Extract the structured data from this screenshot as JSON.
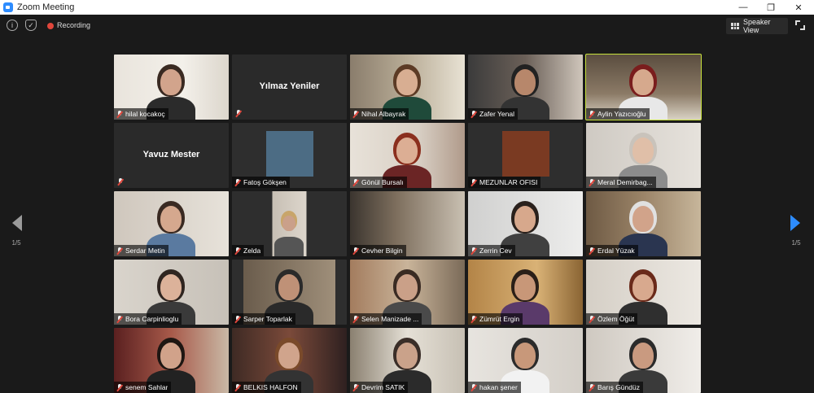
{
  "window": {
    "title": "Zoom Meeting",
    "minimize": "—",
    "maximize": "❐",
    "close": "✕"
  },
  "toolbar": {
    "info_icon": "i",
    "shield_icon": "✓",
    "recording_label": "Recording",
    "speaker_view_label": "Speaker View"
  },
  "pagination": {
    "prev_page": "1/5",
    "next_page": "1/5"
  },
  "colors": {
    "active_speaker_border": "#c6e03a",
    "muted_icon": "#e0463b",
    "nav_next": "#2d8cff",
    "zoom_brand": "#2d8cff"
  },
  "participants": [
    {
      "name": "hilal kocakoç",
      "video": true
    },
    {
      "name": "Yılmaz Yeniler",
      "video": false
    },
    {
      "name": "Nihal Albayrak",
      "video": true
    },
    {
      "name": "Zafer Yenal",
      "video": true
    },
    {
      "name": "Aylin Yazıcıoğlu",
      "video": true,
      "active_speaker": true
    },
    {
      "name": "Yavuz Mester",
      "video": false
    },
    {
      "name": "Fatoş Gökşen",
      "video": true
    },
    {
      "name": "Gönül Bursalı",
      "video": true
    },
    {
      "name": "MEZUNLAR OFISI",
      "video": true
    },
    {
      "name": "Meral Demirbag...",
      "video": true
    },
    {
      "name": "Serdar Metin",
      "video": true
    },
    {
      "name": "Zelda",
      "video": true
    },
    {
      "name": "Cevher Bilgin",
      "video": true
    },
    {
      "name": "Zerrin Cev",
      "video": true
    },
    {
      "name": "Erdal Yüzak",
      "video": true
    },
    {
      "name": "Bora Carpinlioglu",
      "video": true
    },
    {
      "name": "Sarper Toparlak",
      "video": true
    },
    {
      "name": "Selen Manizade ...",
      "video": true
    },
    {
      "name": "Zümrüt Ergin",
      "video": true
    },
    {
      "name": "Özlem Öğüt",
      "video": true
    },
    {
      "name": "senem Sahlar",
      "video": true
    },
    {
      "name": "BELKIS HALFON",
      "video": true
    },
    {
      "name": "Devrim SATIK",
      "video": true
    },
    {
      "name": "hakan şener",
      "video": true
    },
    {
      "name": "Barış Gündüz",
      "video": true
    }
  ]
}
